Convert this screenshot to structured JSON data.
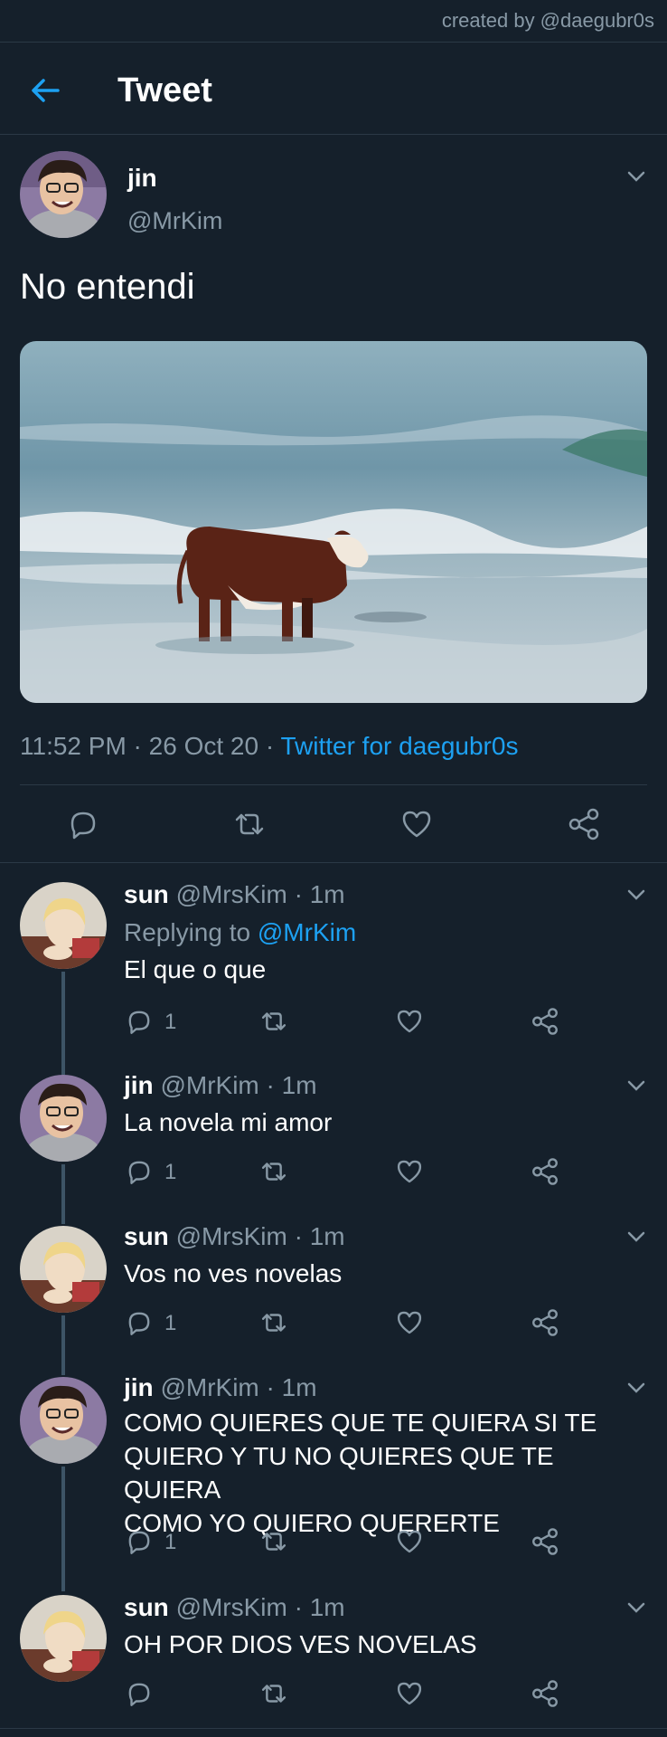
{
  "credit": "created by @daegubr0s",
  "header": {
    "title": "Tweet"
  },
  "main_tweet": {
    "name": "jin",
    "handle": "@MrKim",
    "text": "No entendi",
    "timestamp": "11:52 PM · 26 Oct 20 · ",
    "source": "Twitter for daegubr0s"
  },
  "replies": [
    {
      "name": "sun",
      "handle": "@MrsKim · 1m",
      "replying_prefix": "Replying to ",
      "replying_to": "@MrKim",
      "text": "El que o que",
      "reply_count": "1"
    },
    {
      "name": "jin",
      "handle": "@MrKim · 1m",
      "text": "La novela mi amor",
      "reply_count": "1"
    },
    {
      "name": "sun",
      "handle": "@MrsKim · 1m",
      "text": "Vos no ves novelas",
      "reply_count": "1"
    },
    {
      "name": "jin",
      "handle": "@MrKim · 1m",
      "text_lines": [
        "COMO QUIERES QUE TE QUIERA SI TE",
        "QUIERO Y TU NO QUIERES QUE TE QUIERA",
        "COMO YO QUIERO QUERERTE"
      ],
      "reply_count": "1"
    },
    {
      "name": "sun",
      "handle": "@MrsKim · 1m",
      "text": "OH POR DIOS VES NOVELAS",
      "reply_count": ""
    }
  ],
  "colors": {
    "background": "#15202b",
    "accent": "#1da1f2",
    "muted": "#8899a6",
    "divider": "#2b3946"
  },
  "icons": [
    "back-arrow-icon",
    "chevron-down-icon",
    "reply-icon",
    "retweet-icon",
    "like-icon",
    "share-icon"
  ]
}
